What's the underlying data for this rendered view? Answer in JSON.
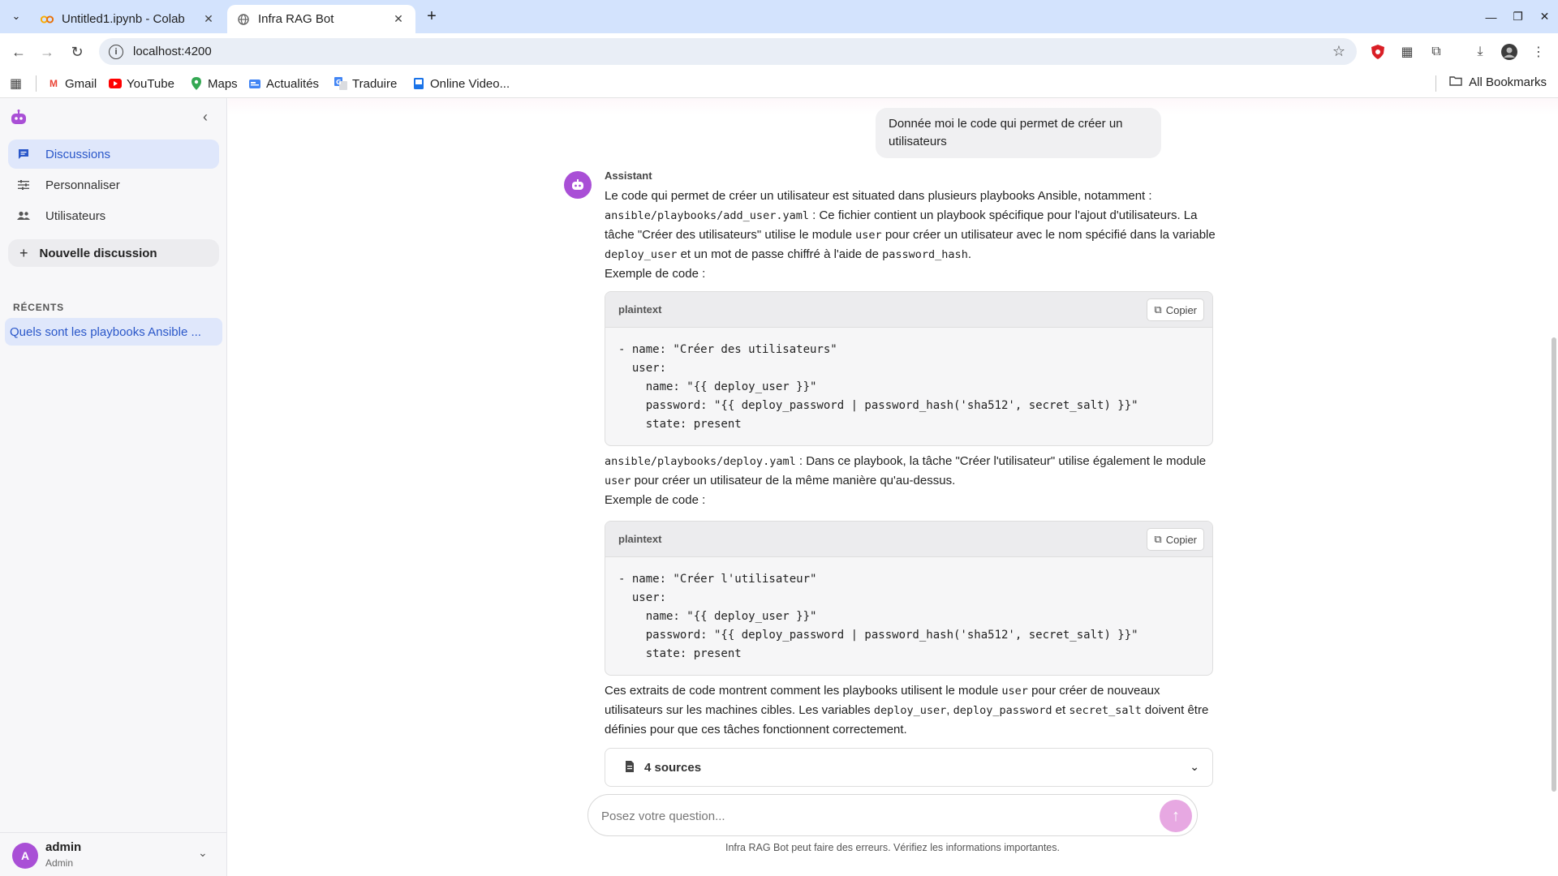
{
  "browser": {
    "tabs": [
      {
        "title": "Untitled1.ipynb - Colab",
        "active": false
      },
      {
        "title": "Infra RAG Bot",
        "active": true
      }
    ],
    "url": "localhost:4200",
    "bookmarks": [
      "Gmail",
      "YouTube",
      "Maps",
      "Actualités",
      "Traduire",
      "Online Video..."
    ],
    "all_bookmarks": "All Bookmarks"
  },
  "sidebar": {
    "nav": [
      {
        "label": "Discussions",
        "icon": "chat-icon",
        "active": true
      },
      {
        "label": "Personnaliser",
        "icon": "sliders-icon",
        "active": false
      },
      {
        "label": "Utilisateurs",
        "icon": "users-icon",
        "active": false
      }
    ],
    "new_chat": "Nouvelle discussion",
    "recent_title": "RÉCENTS",
    "recent_items": [
      "Quels sont les playbooks Ansible ..."
    ],
    "user": {
      "initial": "A",
      "name": "admin",
      "role": "Admin"
    }
  },
  "chat": {
    "user_message": "Donnée moi le code qui permet de créer un utilisateurs",
    "assistant_label": "Assistant",
    "p1_line1": "Le code qui permet de créer un utilisateur est situated dans plusieurs playbooks Ansible, notamment :",
    "p1_file": "ansible/playbooks/add_user.yaml",
    "p1_text_a": " : Ce fichier contient un playbook spécifique pour l'ajout d'utilisateurs. La tâche \"Créer des utilisateurs\" utilise le module ",
    "p1_code_user": "user",
    "p1_text_b": " pour créer un utilisateur avec le nom spécifié dans la variable ",
    "p1_code_deploy": "deploy_user",
    "p1_text_c": " et un mot de passe chiffré à l'aide de ",
    "p1_code_hash": "password_hash",
    "p1_text_d": ".",
    "example_label": "Exemple de code :",
    "code_blocks": [
      {
        "lang": "plaintext",
        "copy": "Copier",
        "code": "- name: \"Créer des utilisateurs\"\n  user:\n    name: \"{{ deploy_user }}\"\n    password: \"{{ deploy_password | password_hash('sha512', secret_salt) }}\"\n    state: present"
      },
      {
        "lang": "plaintext",
        "copy": "Copier",
        "code": "- name: \"Créer l'utilisateur\"\n  user:\n    name: \"{{ deploy_user }}\"\n    password: \"{{ deploy_password | password_hash('sha512', secret_salt) }}\"\n    state: present"
      }
    ],
    "p2_file": "ansible/playbooks/deploy.yaml",
    "p2_text_a": " : Dans ce playbook, la tâche \"Créer l'utilisateur\" utilise également le module ",
    "p2_code_user": "user",
    "p2_text_b": " pour créer un utilisateur de la même manière qu'au-dessus.",
    "p3_text_a": "Ces extraits de code montrent comment les playbooks utilisent le module ",
    "p3_code_user": "user",
    "p3_text_b": " pour créer de nouveaux utilisateurs sur les machines cibles. Les variables ",
    "p3_code_v1": "deploy_user",
    "p3_sep": ", ",
    "p3_code_v2": "deploy_password",
    "p3_text_c": " et ",
    "p3_code_v3": "secret_salt",
    "p3_text_d": " doivent être définies pour que ces tâches fonctionnent correctement.",
    "sources_label": "4 sources",
    "input_placeholder": "Posez votre question...",
    "disclaimer": "Infra RAG Bot peut faire des erreurs. Vérifiez les informations importantes."
  },
  "colors": {
    "accent": "#2a57c9",
    "avatar": "#a94fd6",
    "send": "#e7a8e2"
  }
}
